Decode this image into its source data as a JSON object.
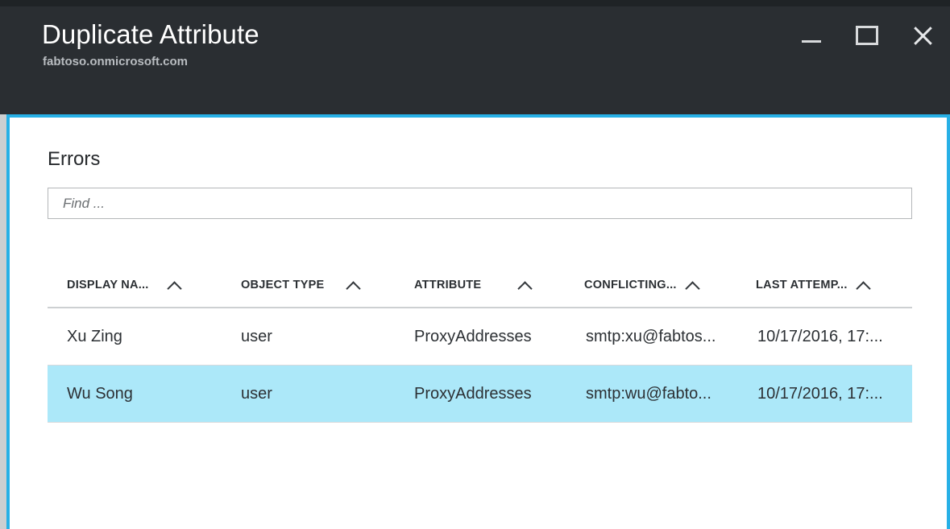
{
  "window": {
    "title": "Duplicate Attribute",
    "subtitle": "fabtoso.onmicrosoft.com",
    "controls": {
      "minimize_label": "Minimize",
      "maximize_label": "Restore",
      "close_label": "Close"
    },
    "accent_color": "#27b0e6",
    "titlebar_color": "#2a2e32"
  },
  "content": {
    "heading": "Errors",
    "search": {
      "placeholder": "Find ...",
      "value": ""
    },
    "table": {
      "columns": [
        {
          "label": "DISPLAY NA...",
          "sort": "asc"
        },
        {
          "label": "OBJECT TYPE",
          "sort": "asc"
        },
        {
          "label": "ATTRIBUTE",
          "sort": "asc"
        },
        {
          "label": "CONFLICTING...",
          "sort": "asc"
        },
        {
          "label": "LAST ATTEMP...",
          "sort": "asc"
        }
      ],
      "rows": [
        {
          "display_name": "Xu Zing",
          "object_type": "user",
          "attribute": "ProxyAddresses",
          "conflicting_value": "smtp:xu@fabtos...",
          "last_attempt": "10/17/2016, 17:...",
          "selected": false
        },
        {
          "display_name": "Wu Song",
          "object_type": "user",
          "attribute": "ProxyAddresses",
          "conflicting_value": "smtp:wu@fabto...",
          "last_attempt": "10/17/2016, 17:...",
          "selected": true
        }
      ],
      "selected_row_color": "#ace8f9"
    }
  }
}
